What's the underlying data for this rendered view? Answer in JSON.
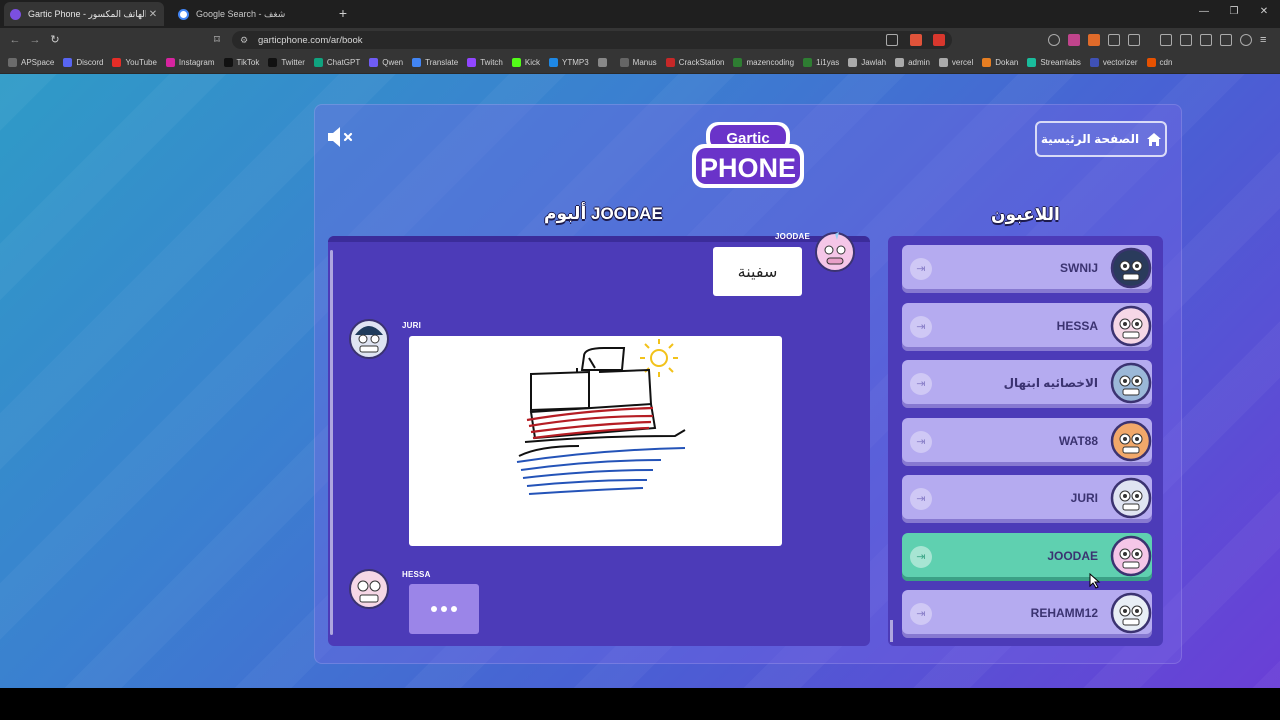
{
  "browser": {
    "tabs": [
      {
        "title": "Gartic Phone - لعبة الهاتف المكسور",
        "active": true
      },
      {
        "title": "Google Search - شغف",
        "active": false
      }
    ],
    "url": "garticphone.com/ar/book",
    "bookmarks": [
      "APSpace",
      "Discord",
      "YouTube",
      "Instagram",
      "TikTok",
      "Twitter",
      "ChatGPT",
      "Qwen",
      "Translate",
      "Twitch",
      "Kick",
      "YTMP3",
      "",
      "Manus",
      "CrackStation",
      "mazencoding",
      "1i1yas",
      "Jawlah",
      "admin",
      "vercel",
      "Dokan",
      "Streamlabs",
      "vectorizer",
      "cdn"
    ]
  },
  "game": {
    "home_label": "الصفحة الرئيسية",
    "logo_top": "Gartic",
    "logo_bottom": "PHONE",
    "album_title": "ألبوم JOODAE",
    "players_title": "اللاعبون",
    "messages": [
      {
        "author": "JOODAE",
        "type": "text",
        "text": "سفينة"
      },
      {
        "author": "JURI",
        "type": "drawing"
      },
      {
        "author": "HESSA",
        "type": "typing"
      }
    ],
    "players": [
      {
        "name": "SWNIJ",
        "active": false
      },
      {
        "name": "HESSA",
        "active": false
      },
      {
        "name": "الاخصائيه ابتهال",
        "active": false
      },
      {
        "name": "WAT88",
        "active": false
      },
      {
        "name": "JURI",
        "active": false
      },
      {
        "name": "JOODAE",
        "active": true
      },
      {
        "name": "REHAMM12",
        "active": false
      }
    ]
  },
  "colors": {
    "panel": "#4c3bb8",
    "player_row": "#b5abf0",
    "player_active": "#5fd0b0",
    "accent_dark": "#3b3371"
  }
}
